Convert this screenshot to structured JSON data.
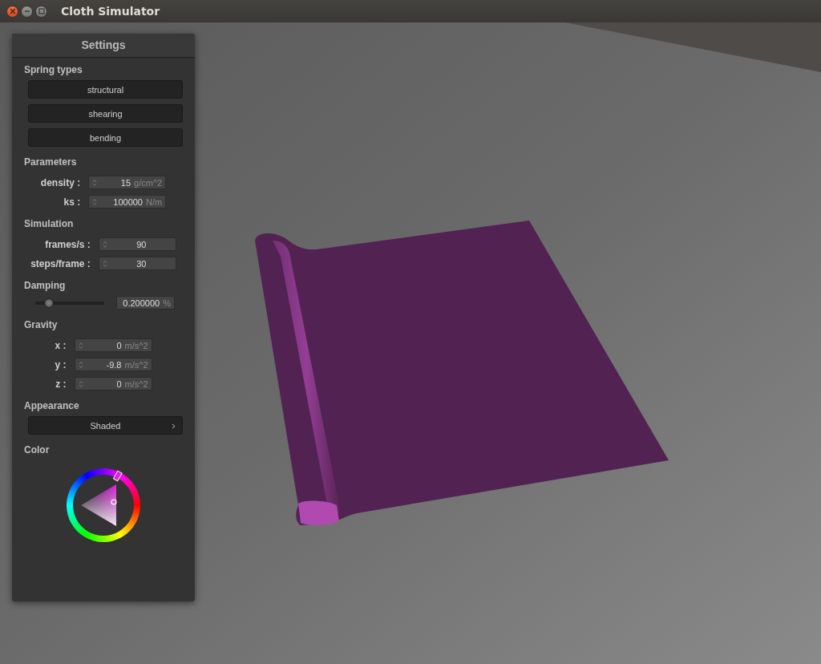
{
  "window": {
    "title": "Cloth Simulator"
  },
  "settings": {
    "title": "Settings",
    "sections": [
      {
        "kind": "buttons",
        "title": "Spring types",
        "buttons": [
          "structural",
          "shearing",
          "bending"
        ]
      },
      {
        "kind": "fields",
        "title": "Parameters",
        "fields": [
          {
            "label": "density :",
            "value": "15",
            "unit": "g/cm^2"
          },
          {
            "label": "ks :",
            "value": "100000",
            "unit": "N/m"
          }
        ]
      },
      {
        "kind": "fields",
        "title": "Simulation",
        "fields": [
          {
            "label": "frames/s :",
            "value": "90"
          },
          {
            "label": "steps/frame :",
            "value": "30"
          }
        ]
      },
      {
        "kind": "slider",
        "title": "Damping",
        "level": 0.2,
        "value": "0.200000",
        "unit": "%"
      },
      {
        "kind": "fields",
        "title": "Gravity",
        "fields": [
          {
            "label": "x :",
            "value": "0",
            "unit": "m/s^2"
          },
          {
            "label": "y :",
            "value": "-9.8",
            "unit": "m/s^2"
          },
          {
            "label": "z :",
            "value": "0",
            "unit": "m/s^2"
          }
        ]
      },
      {
        "kind": "dropdown",
        "title": "Appearance",
        "value": "Shaded"
      },
      {
        "kind": "color",
        "title": "Color",
        "color": "#e020e0"
      }
    ]
  }
}
